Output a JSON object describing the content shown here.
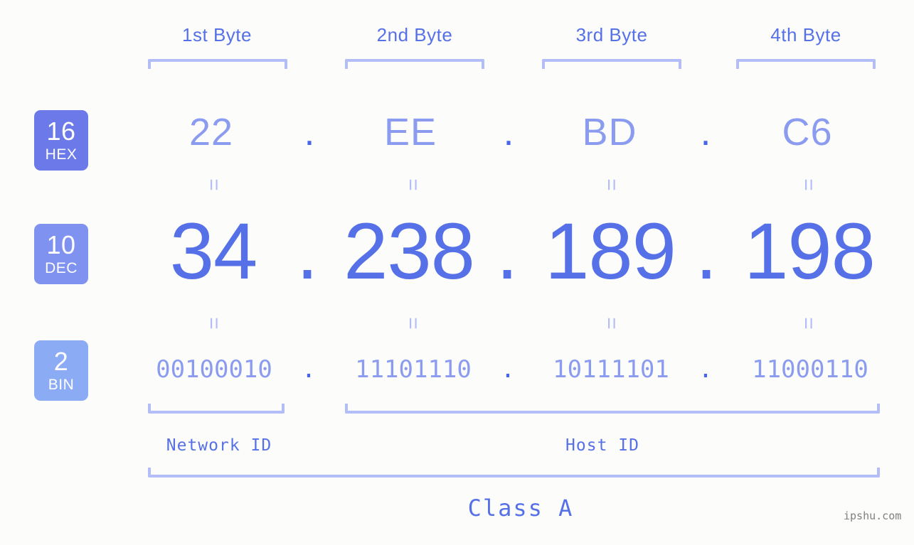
{
  "meta": {
    "watermark": "ipshu.com",
    "background_color": "#fcfdfa",
    "accent_color": "#5670e8",
    "light_accent_color": "#8b9cf0",
    "bracket_color": "#b3bdf7"
  },
  "byte_headers": [
    {
      "label": "1st Byte"
    },
    {
      "label": "2nd Byte"
    },
    {
      "label": "3rd Byte"
    },
    {
      "label": "4th Byte"
    }
  ],
  "bases": [
    {
      "number": "16",
      "name": "HEX",
      "color": "#6b7ae8"
    },
    {
      "number": "10",
      "name": "DEC",
      "color": "#7f92f0"
    },
    {
      "number": "2",
      "name": "BIN",
      "color": "#8babf5"
    }
  ],
  "rows": {
    "hex": {
      "base_number": "16",
      "base_name": "HEX",
      "values": [
        "22",
        "EE",
        "BD",
        "C6"
      ],
      "separator": "."
    },
    "dec": {
      "base_number": "10",
      "base_name": "DEC",
      "values": [
        "34",
        "238",
        "189",
        "198"
      ],
      "separator": "."
    },
    "bin": {
      "base_number": "2",
      "base_name": "BIN",
      "values": [
        "00100010",
        "11101110",
        "10111101",
        "11000110"
      ],
      "separator": "."
    }
  },
  "equals_marks": {
    "symbol": "=",
    "count_per_row": 4
  },
  "segments": {
    "network_id": {
      "label": "Network ID"
    },
    "host_id": {
      "label": "Host ID"
    },
    "class": {
      "label": "Class A"
    }
  },
  "ip_address": {
    "hex": "22.EE.BD.C6",
    "dec": "34.238.189.198",
    "bin": "00100010.11101110.10111101.11000110"
  }
}
